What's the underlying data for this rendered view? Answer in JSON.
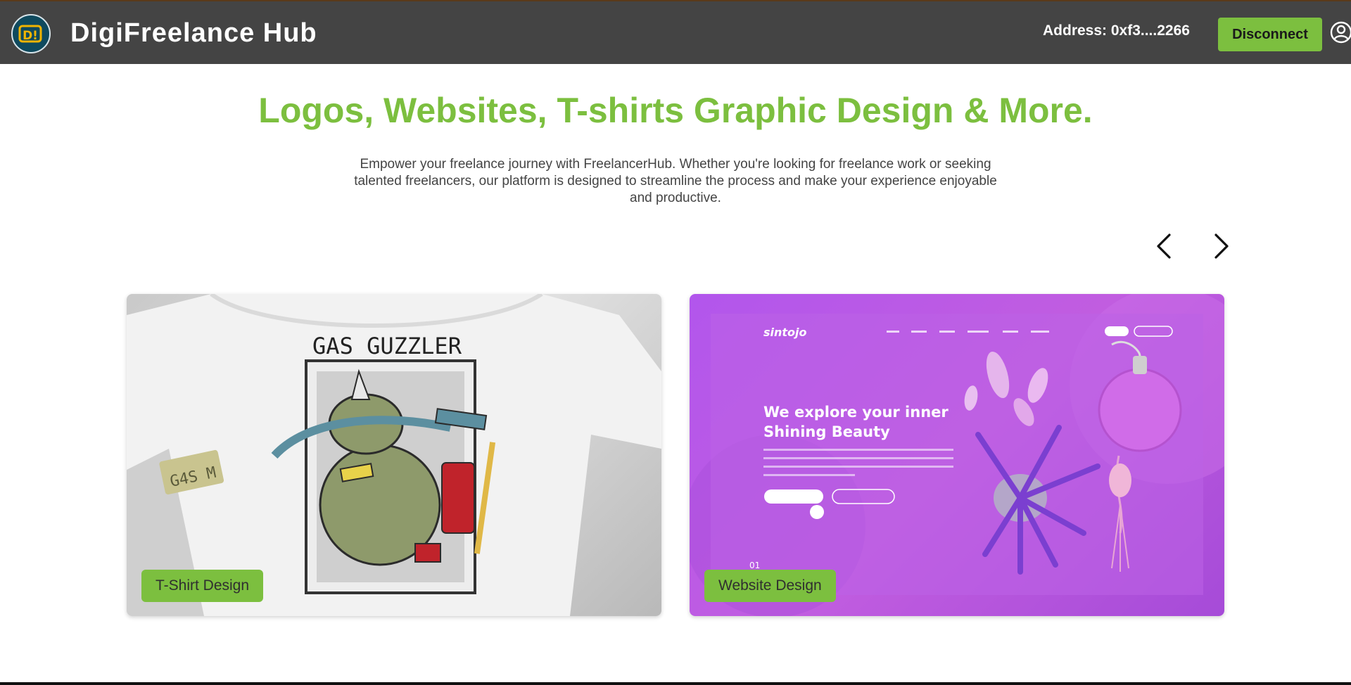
{
  "header": {
    "logo_text": "D!",
    "brand": "DigiFreelance Hub",
    "address": "Address: 0xf3....2266",
    "disconnect_label": "Disconnect",
    "icons": [
      "user-circle-icon"
    ]
  },
  "hero": {
    "title": "Logos, Websites, T-shirts Graphic Design & More.",
    "description": "Empower your freelance journey with FreelancerHub. Whether you're looking for freelance work or seeking talented freelancers, our platform is designed to streamline the process and make your experience enjoyable and productive."
  },
  "carousel": {
    "prev_icon": "chevron-left-icon",
    "next_icon": "chevron-right-icon",
    "cards": [
      {
        "label": "T-Shirt Design",
        "image_text_title": "GAS GUZZLER",
        "image_text_tag": "G4S M"
      },
      {
        "label": "Website Design",
        "image_brand": "sintojo",
        "image_headline_1": "We explore your inner",
        "image_headline_2": "Shining Beauty",
        "image_number": "01"
      }
    ]
  },
  "colors": {
    "accent": "#7cbf3f",
    "header_bg": "#444444",
    "text_muted": "#444444"
  }
}
